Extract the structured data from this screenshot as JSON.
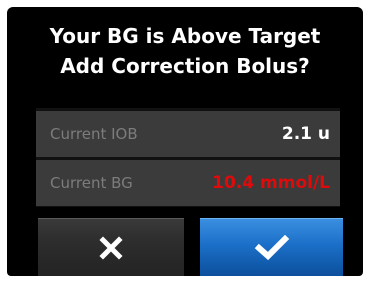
{
  "dialog": {
    "title_line1": "Your BG is Above Target",
    "title_line2": "Add Correction Bolus?"
  },
  "info": {
    "iob": {
      "label": "Current IOB",
      "value": "2.1 u",
      "value_color": "#ffffff"
    },
    "bg": {
      "label": "Current BG",
      "value": "10.4 mmol/L",
      "value_color": "#e10a0a"
    }
  },
  "buttons": {
    "cancel": {
      "icon": "close-icon"
    },
    "confirm": {
      "icon": "checkmark-icon",
      "color": "#1b6fc8"
    }
  }
}
